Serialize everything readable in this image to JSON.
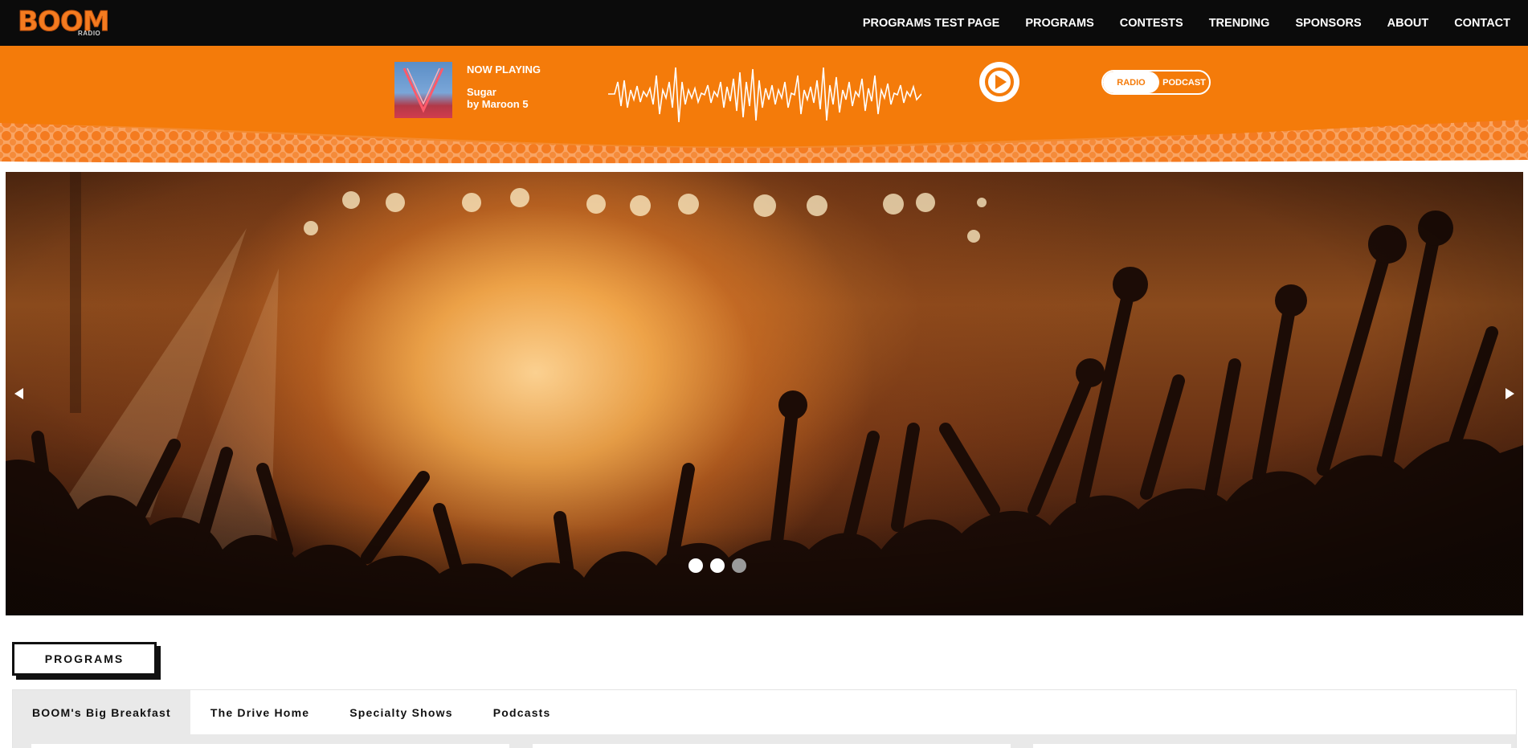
{
  "brand": {
    "logo_text": "BOOM",
    "logo_sub": "RADIO",
    "accent": "#f47b0a",
    "dark": "#0b0b0b"
  },
  "nav": {
    "items": [
      {
        "label": "PROGRAMS TEST PAGE"
      },
      {
        "label": "PROGRAMS"
      },
      {
        "label": "CONTESTS"
      },
      {
        "label": "TRENDING"
      },
      {
        "label": "SPONSORS"
      },
      {
        "label": "ABOUT"
      },
      {
        "label": "CONTACT"
      }
    ]
  },
  "now_playing": {
    "label": "NOW PLAYING",
    "song": "Sugar",
    "artist_line": "by Maroon 5",
    "play_icon": "play-icon"
  },
  "toggle": {
    "options": [
      "RADIO",
      "PODCAST"
    ],
    "selected": "RADIO"
  },
  "carousel": {
    "prev_icon": "triangle-left-icon",
    "next_icon": "triangle-right-icon",
    "slide_count": 3,
    "active_slides": [
      1,
      2
    ]
  },
  "programs": {
    "heading": "PROGRAMS",
    "tabs": [
      {
        "label": "BOOM's Big Breakfast",
        "active": true
      },
      {
        "label": "The Drive Home",
        "active": false
      },
      {
        "label": "Specialty Shows",
        "active": false
      },
      {
        "label": "Podcasts",
        "active": false
      }
    ]
  }
}
